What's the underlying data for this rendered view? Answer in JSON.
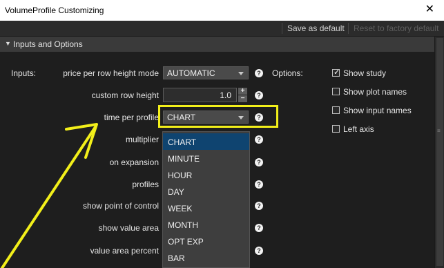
{
  "window": {
    "title": "VolumeProfile Customizing",
    "close_glyph": "✕"
  },
  "toolbar": {
    "save_label": "Save as default",
    "reset_label": "Reset to factory default"
  },
  "section": {
    "label": "Inputs and Options",
    "expanded": true
  },
  "inputs_label": "Inputs:",
  "options_label": "Options:",
  "inputs": [
    {
      "name": "price per row height mode",
      "type": "select",
      "value": "AUTOMATIC"
    },
    {
      "name": "custom row height",
      "type": "number",
      "value": "1.0"
    },
    {
      "name": "time per profile",
      "type": "select",
      "value": "CHART"
    },
    {
      "name": "multiplier"
    },
    {
      "name": "on expansion"
    },
    {
      "name": "profiles"
    },
    {
      "name": "show point of control"
    },
    {
      "name": "show value area"
    },
    {
      "name": "value area percent"
    }
  ],
  "stepper": {
    "plus": "+",
    "minus": "−"
  },
  "options": [
    {
      "label": "Show study",
      "checked": true
    },
    {
      "label": "Show plot names",
      "checked": false
    },
    {
      "label": "Show input names",
      "checked": false
    },
    {
      "label": "Left axis",
      "checked": false
    }
  ],
  "dropdown": {
    "selected": "CHART",
    "items": [
      "CHART",
      "MINUTE",
      "HOUR",
      "DAY",
      "WEEK",
      "MONTH",
      "OPT EXP",
      "BAR"
    ]
  },
  "help_glyph": "?",
  "check_glyph": "✓",
  "colors": {
    "annotation": "#f2ef1a",
    "selection": "#0f4470",
    "background": "#1e1e1e"
  }
}
